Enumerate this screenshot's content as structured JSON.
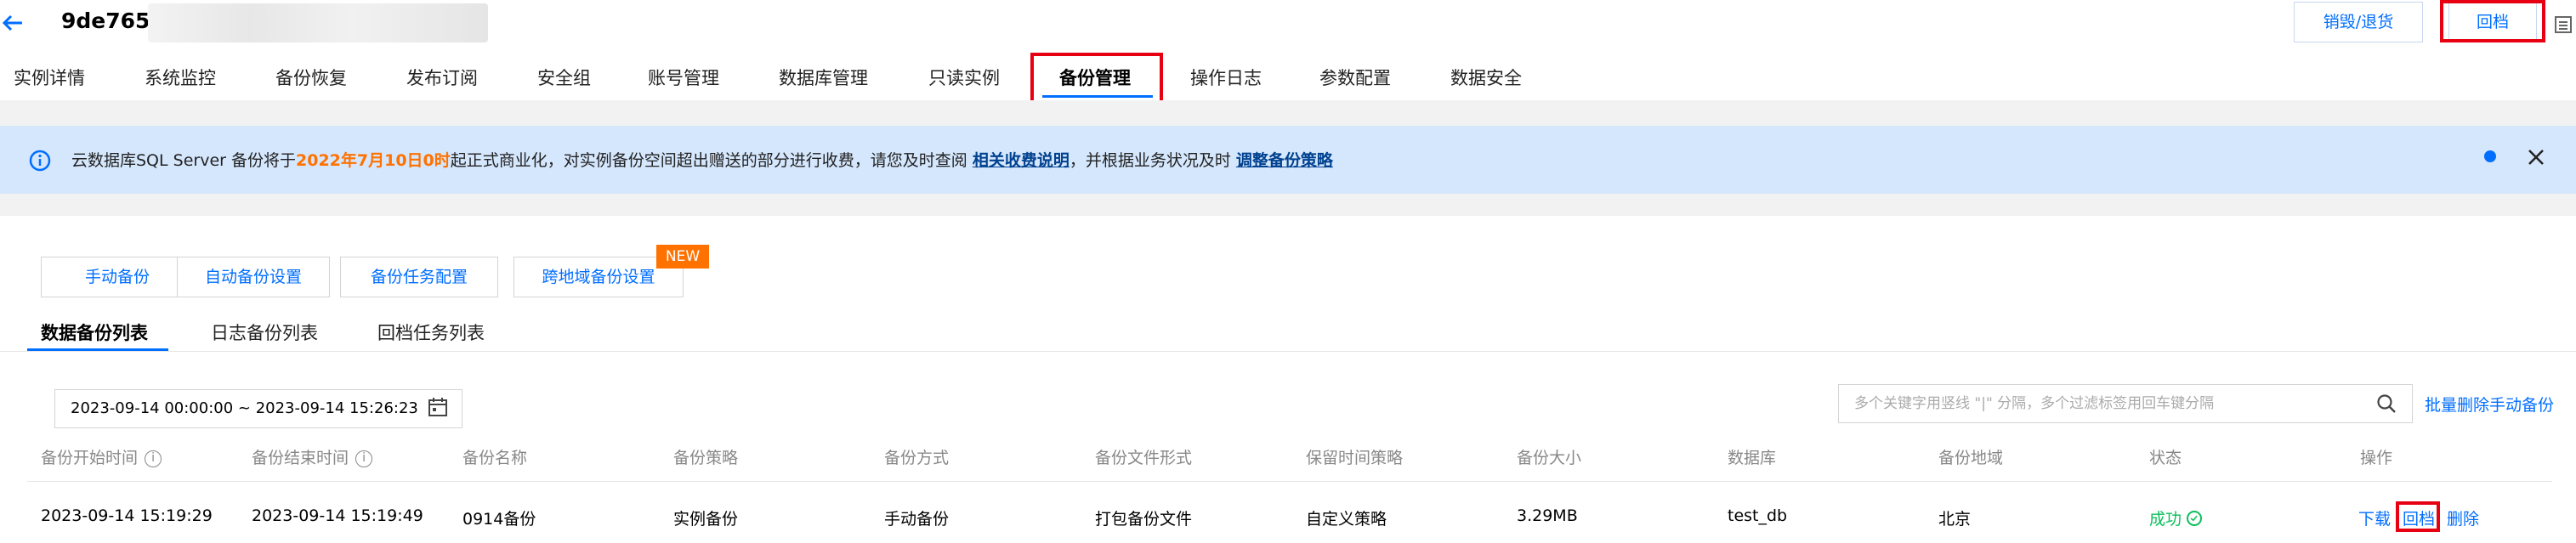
{
  "header": {
    "instance_id": "9de765",
    "destroy_label": "销毁/退货",
    "restore_label": "回档"
  },
  "tabs": [
    {
      "label": "实例详情"
    },
    {
      "label": "系统监控"
    },
    {
      "label": "备份恢复"
    },
    {
      "label": "发布订阅"
    },
    {
      "label": "安全组"
    },
    {
      "label": "账号管理"
    },
    {
      "label": "数据库管理"
    },
    {
      "label": "只读实例"
    },
    {
      "label": "备份管理",
      "active": true
    },
    {
      "label": "操作日志"
    },
    {
      "label": "参数配置"
    },
    {
      "label": "数据安全"
    }
  ],
  "notice": {
    "text_before": "云数据库SQL Server 备份将于",
    "highlight": "2022年7月10日0时",
    "text_mid": "起正式商业化，对实例备份空间超出赠送的部分进行收费，请您及时查阅 ",
    "link1": "相关收费说明",
    "text_mid2": "，并根据业务状况及时 ",
    "link2": "调整备份策略"
  },
  "actions": {
    "manual_backup": "手动备份",
    "auto_backup_settings": "自动备份设置",
    "backup_task_config": "备份任务配置",
    "cross_region_backup": "跨地域备份设置",
    "new_badge": "NEW"
  },
  "subtabs": [
    {
      "label": "数据备份列表",
      "active": true
    },
    {
      "label": "日志备份列表"
    },
    {
      "label": "回档任务列表"
    }
  ],
  "filter": {
    "date_range": "2023-09-14 00:00:00  ~ 2023-09-14 15:26:23",
    "search_placeholder": "多个关键字用竖线 \"|\" 分隔，多个过滤标签用回车键分隔",
    "bulk_delete": "批量删除手动备份"
  },
  "table": {
    "columns": [
      "备份开始时间",
      "备份结束时间",
      "备份名称",
      "备份策略",
      "备份方式",
      "备份文件形式",
      "保留时间策略",
      "备份大小",
      "数据库",
      "备份地域",
      "状态",
      "操作"
    ],
    "rows": [
      {
        "start": "2023-09-14 15:19:29",
        "end": "2023-09-14 15:19:49",
        "name": "0914备份",
        "policy": "实例备份",
        "method": "手动备份",
        "file_form": "打包备份文件",
        "retention": "自定义策略",
        "size": "3.29MB",
        "database": "test_db",
        "region": "北京",
        "status": "成功",
        "ops": [
          "下载",
          "回档",
          "删除"
        ]
      }
    ]
  },
  "colors": {
    "accent": "#006eff",
    "highlight_box": "#e60012",
    "notice_bg": "#d5e7fd",
    "warning": "#ff7200",
    "success": "#0abf5b"
  }
}
